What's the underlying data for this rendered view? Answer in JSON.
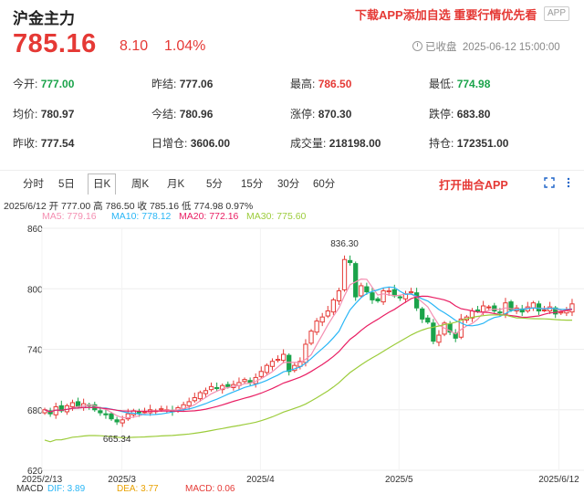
{
  "header": {
    "title": "沪金主力",
    "promo": "下载APP添加自选 重要行情优先看",
    "app_badge": "APP",
    "price": "785.16",
    "change": "8.10",
    "change_pct": "1.04%",
    "status": "已收盘",
    "datetime": "2025-06-12 15:00:00"
  },
  "stats": {
    "open_label": "今开:",
    "open_value": "777.00",
    "prev_settle_label": "昨结:",
    "prev_settle_value": "777.06",
    "high_label": "最高:",
    "high_value": "786.50",
    "low_label": "最低:",
    "low_value": "774.98",
    "avg_label": "均价:",
    "avg_value": "780.97",
    "settle_label": "今结:",
    "settle_value": "780.96",
    "limit_up_label": "涨停:",
    "limit_up_value": "870.30",
    "limit_down_label": "跌停:",
    "limit_down_value": "683.80",
    "prev_close_label": "昨收:",
    "prev_close_value": "777.54",
    "oi_change_label": "日增仓:",
    "oi_change_value": "3606.00",
    "volume_label": "成交量:",
    "volume_value": "218198.00",
    "open_interest_label": "持仓:",
    "open_interest_value": "172351.00"
  },
  "tabs": [
    "分时",
    "5日",
    "日K",
    "周K",
    "月K",
    "5分",
    "15分",
    "30分",
    "60分"
  ],
  "open_app": "打开曲合APP",
  "info_line": "2025/6/12  开 777.00  高 786.50  收 785.16  低 774.98  0.97%",
  "ma": {
    "ma5": "MA5: 779.16",
    "ma10": "MA10: 778.12",
    "ma20": "MA20: 772.16",
    "ma30": "MA30: 775.60"
  },
  "macd": {
    "title": "MACD",
    "dif": "DIF: 3.89",
    "dea": "DEA: 3.77",
    "macd": "MACD: 0.06"
  },
  "colors": {
    "up": "#e53935",
    "down": "#1aa34a",
    "ma5": "#f48fb1",
    "ma10": "#29b6f6",
    "ma20": "#e91e63",
    "ma30": "#9ccc3b"
  },
  "chart_data": {
    "type": "candlestick",
    "ylim": [
      620,
      860
    ],
    "y_ticks": [
      "860",
      "800",
      "740",
      "680",
      "620"
    ],
    "x_ticks": [
      "2025/2/13",
      "2025/3",
      "2025/4",
      "2025/5",
      "2025/6/12"
    ],
    "annotations": [
      {
        "text": "836.30",
        "label": "high"
      },
      {
        "text": "665.34",
        "label": "low"
      }
    ],
    "close": [
      680,
      676,
      683,
      679,
      684,
      687,
      683,
      686,
      684,
      680,
      677,
      675,
      671,
      668,
      670,
      676,
      679,
      677,
      678,
      680,
      679,
      681,
      680,
      678,
      682,
      685,
      688,
      692,
      697,
      699,
      703,
      701,
      704,
      703,
      705,
      707,
      710,
      707,
      712,
      718,
      724,
      728,
      730,
      735,
      718,
      724,
      728,
      745,
      758,
      768,
      772,
      778,
      789,
      798,
      829,
      826,
      792,
      803,
      797,
      789,
      788,
      798,
      798,
      793,
      791,
      795,
      797,
      781,
      770,
      767,
      748,
      754,
      766,
      757,
      751,
      770,
      772,
      778,
      778,
      783,
      782,
      778,
      776,
      786,
      779,
      781,
      777,
      782,
      786,
      778,
      779,
      782,
      775,
      777,
      778,
      785
    ],
    "ma5_end": 779.16,
    "ma10_end": 778.12,
    "ma20_end": 772.16,
    "ma30_end": 775.6
  }
}
